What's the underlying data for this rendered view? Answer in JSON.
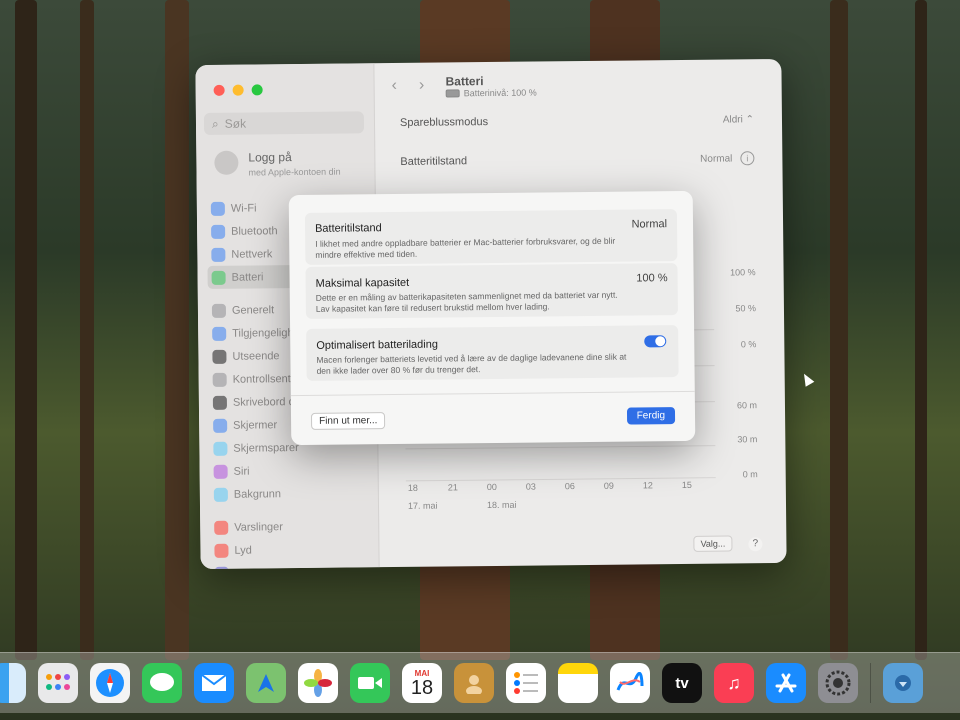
{
  "window": {
    "search_placeholder": "Søk",
    "login": {
      "title": "Logg på",
      "subtitle": "med Apple-kontoen din"
    },
    "sidebar": [
      {
        "label": "Wi-Fi",
        "icon": "wifi-icon",
        "color": "#3b82f6"
      },
      {
        "label": "Bluetooth",
        "icon": "bluetooth-icon",
        "color": "#3b82f6"
      },
      {
        "label": "Nettverk",
        "icon": "globe-icon",
        "color": "#3b82f6"
      },
      {
        "label": "Batteri",
        "icon": "battery-icon",
        "color": "#34c759",
        "active": true
      },
      {
        "label": "Generelt",
        "icon": "gear-icon",
        "color": "#8e8e93"
      },
      {
        "label": "Tilgjengelighet",
        "icon": "accessibility-icon",
        "color": "#3b82f6"
      },
      {
        "label": "Utseende",
        "icon": "appearance-icon",
        "color": "#1c1c1e"
      },
      {
        "label": "Kontrollsenter",
        "icon": "control-center-icon",
        "color": "#8e8e93"
      },
      {
        "label": "Skrivebord og Dock",
        "icon": "desktop-icon",
        "color": "#1c1c1e"
      },
      {
        "label": "Skjermer",
        "icon": "display-icon",
        "color": "#3b82f6"
      },
      {
        "label": "Skjermsparer",
        "icon": "screensaver-icon",
        "color": "#5ac8fa"
      },
      {
        "label": "Siri",
        "icon": "siri-icon",
        "color": "#af52de"
      },
      {
        "label": "Bakgrunn",
        "icon": "wallpaper-icon",
        "color": "#5ac8fa"
      },
      {
        "label": "Varslinger",
        "icon": "bell-icon",
        "color": "#ff3b30"
      },
      {
        "label": "Lyd",
        "icon": "speaker-icon",
        "color": "#ff3b30"
      },
      {
        "label": "Fokus",
        "icon": "moon-icon",
        "color": "#5856d6"
      }
    ],
    "title": "Batteri",
    "subtitle": "Batterinivå: 100 %",
    "rows": [
      {
        "label": "Spareblussmodus",
        "value": "Aldri ⌃"
      },
      {
        "label": "Batteritilstand",
        "value": "Normal"
      }
    ],
    "chart_labels": {
      "pct": [
        "100 %",
        "50 %",
        "0 %"
      ],
      "min": [
        "60 m",
        "30 m",
        "0 m"
      ],
      "hours": [
        "18",
        "21",
        "00",
        "03",
        "06",
        "09",
        "12",
        "15"
      ],
      "days": [
        "17. mai",
        "18. mai"
      ]
    },
    "valg_button": "Valg...",
    "help_button": "?"
  },
  "dialog": {
    "cards": [
      {
        "title": "Batteritilstand",
        "value": "Normal",
        "description": "I likhet med andre oppladbare batterier er Mac-batterier forbruksvarer, og de blir mindre effektive med tiden."
      },
      {
        "title": "Maksimal kapasitet",
        "value": "100 %",
        "description": "Dette er en måling av batterikapasiteten sammenlignet med da batteriet var nytt. Lav kapasitet kan føre til redusert brukstid mellom hver lading."
      },
      {
        "title": "Optimalisert batterilading",
        "toggle_on": true,
        "description": "Macen forlenger batteriets levetid ved å lære av de daglige ladevanene dine slik at den ikke lader over 80 % før du trenger det."
      }
    ],
    "more_button": "Finn ut mer...",
    "done_button": "Ferdig"
  },
  "dock": {
    "calendar": {
      "month": "MAI",
      "day": "18"
    },
    "tv_label": "tv"
  }
}
